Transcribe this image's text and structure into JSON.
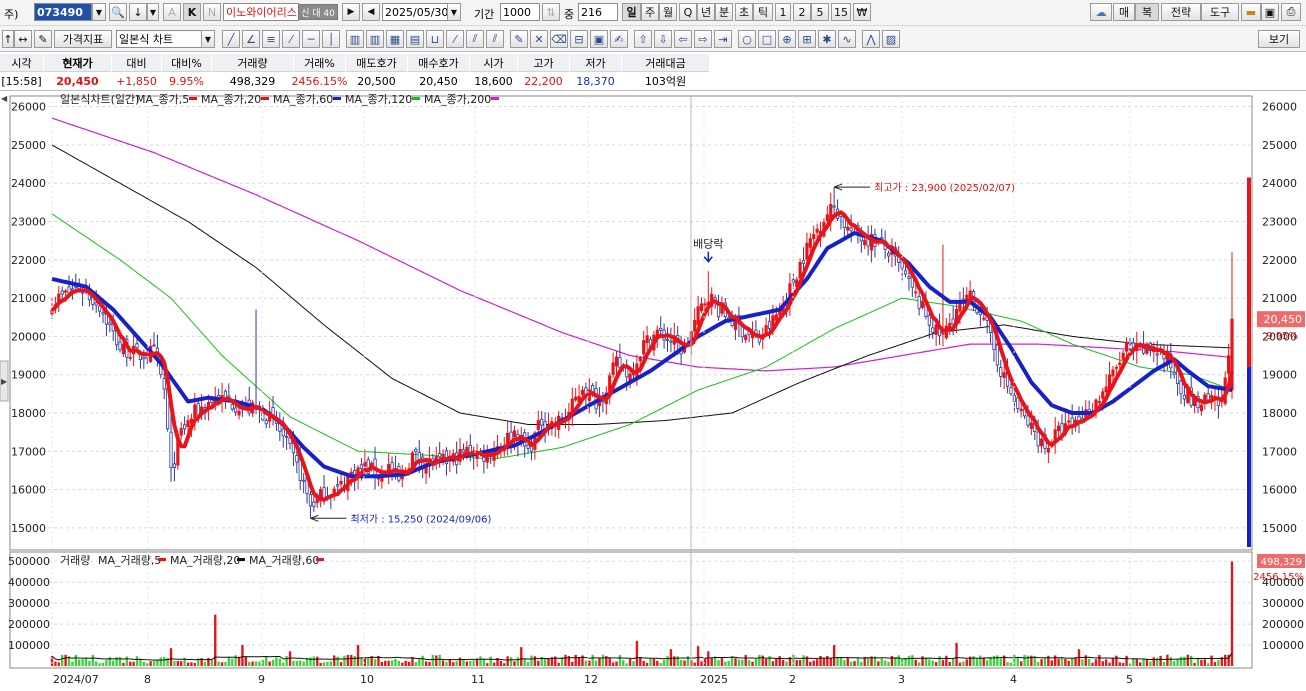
{
  "toolbar": {
    "code_label": "주)",
    "code_value": "073490",
    "stock_name": "이노와이어리스",
    "stock_badge": "신 대 40",
    "date_value": "2025/05/30",
    "period_label": "기간",
    "period_value": "1000",
    "count_label": "중",
    "count_value": "216",
    "buttons_top": [
      "일",
      "주",
      "월",
      "Q",
      "년",
      "분",
      "초",
      "틱",
      "1",
      "2",
      "5",
      "15",
      "₩"
    ],
    "right_buttons": [
      "매",
      "복",
      "전략",
      "도구"
    ],
    "letter_buttons": [
      "A",
      "K",
      "N"
    ],
    "indicator_label": "가격지표",
    "chart_type": "일본식 차트",
    "view_label": "보기"
  },
  "quote": {
    "headers": [
      "시각",
      "현재가",
      "대비",
      "대비%",
      "거래량",
      "거래%",
      "매도호가",
      "매수호가",
      "시가",
      "고가",
      "저가",
      "거래대금"
    ],
    "values": [
      "[15:58]",
      "20,450",
      "+1,850",
      "9.95%",
      "498,329",
      "2456.15%",
      "20,500",
      "20,450",
      "18,600",
      "22,200",
      "18,370",
      "103억원"
    ]
  },
  "legend": {
    "price_title": "일본식차트(일간)",
    "price_items": [
      {
        "label": "MA_종가,5",
        "color": "#e8141a"
      },
      {
        "label": "MA_종가,20",
        "color": "#e8141a"
      },
      {
        "label": "MA_종가,60",
        "color": "#1622c8"
      },
      {
        "label": "MA_종가,120",
        "color": "#19c019"
      },
      {
        "label": "MA_종가,200",
        "color": "#d020d0"
      }
    ],
    "volume_title": "거래량",
    "volume_items": [
      {
        "label": "MA_거래량,5",
        "color": "#e8141a"
      },
      {
        "label": "MA_거래량,20",
        "color": "#111111"
      },
      {
        "label": "MA_거래량,60",
        "color": "#e8141a"
      }
    ]
  },
  "annotations": {
    "high": "최고가 : 23,900 (2025/02/07)",
    "low": "최저가 : 15,250 (2024/09/06)",
    "dividend": "배당락"
  },
  "right_labels": {
    "price": "20,450",
    "pct": "9.95%",
    "volume": "498,329",
    "volume_pct": "2456.15%"
  },
  "chart_data": {
    "type": "candlestick",
    "price_axis": {
      "ticks": [
        15000,
        16000,
        17000,
        18000,
        19000,
        20000,
        21000,
        22000,
        23000,
        24000,
        25000,
        26000
      ],
      "ylim": [
        14500,
        26200
      ]
    },
    "volume_axis": {
      "ticks": [
        100000,
        200000,
        300000,
        400000,
        500000
      ],
      "ylim": [
        0,
        520000
      ]
    },
    "x_ticks": [
      "2024/07",
      "8",
      "9",
      "10",
      "11",
      "12",
      "2025",
      "2",
      "3",
      "4",
      "5"
    ],
    "close_anchors": [
      [
        0,
        20900
      ],
      [
        8,
        21300
      ],
      [
        14,
        20800
      ],
      [
        20,
        19700
      ],
      [
        26,
        19500
      ],
      [
        30,
        19600
      ],
      [
        33,
        18600
      ],
      [
        35,
        16400
      ],
      [
        38,
        17500
      ],
      [
        42,
        18000
      ],
      [
        48,
        18400
      ],
      [
        55,
        18200
      ],
      [
        62,
        18000
      ],
      [
        66,
        17700
      ],
      [
        70,
        17000
      ],
      [
        73,
        16400
      ],
      [
        76,
        15600
      ],
      [
        80,
        15900
      ],
      [
        84,
        16000
      ],
      [
        88,
        16400
      ],
      [
        92,
        16600
      ],
      [
        96,
        16400
      ],
      [
        99,
        16600
      ],
      [
        102,
        16200
      ],
      [
        106,
        16900
      ],
      [
        110,
        16700
      ],
      [
        114,
        16700
      ],
      [
        118,
        16800
      ],
      [
        122,
        17000
      ],
      [
        127,
        16900
      ],
      [
        132,
        17200
      ],
      [
        136,
        17500
      ],
      [
        140,
        17000
      ],
      [
        144,
        17800
      ],
      [
        148,
        17700
      ],
      [
        152,
        18000
      ],
      [
        156,
        18700
      ],
      [
        160,
        18300
      ],
      [
        162,
        18500
      ],
      [
        166,
        19300
      ],
      [
        170,
        19000
      ],
      [
        174,
        19800
      ],
      [
        178,
        20100
      ],
      [
        182,
        19900
      ],
      [
        186,
        19600
      ],
      [
        190,
        20600
      ],
      [
        193,
        21100
      ],
      [
        196,
        20700
      ],
      [
        200,
        20400
      ],
      [
        204,
        20100
      ],
      [
        208,
        19900
      ],
      [
        212,
        20400
      ],
      [
        216,
        21000
      ],
      [
        220,
        21900
      ],
      [
        223,
        22500
      ],
      [
        227,
        23100
      ],
      [
        230,
        23400
      ],
      [
        234,
        22800
      ],
      [
        238,
        22600
      ],
      [
        242,
        22500
      ],
      [
        246,
        22200
      ],
      [
        250,
        21700
      ],
      [
        253,
        21200
      ],
      [
        256,
        20700
      ],
      [
        260,
        20100
      ],
      [
        262,
        20000
      ],
      [
        266,
        20700
      ],
      [
        270,
        21000
      ],
      [
        274,
        20600
      ],
      [
        276,
        19900
      ],
      [
        280,
        18900
      ],
      [
        284,
        18100
      ],
      [
        288,
        17600
      ],
      [
        292,
        17100
      ],
      [
        296,
        17500
      ],
      [
        300,
        17700
      ],
      [
        304,
        18000
      ],
      [
        308,
        18400
      ],
      [
        312,
        19000
      ],
      [
        316,
        19700
      ],
      [
        320,
        19600
      ],
      [
        324,
        19700
      ],
      [
        328,
        19400
      ],
      [
        332,
        18700
      ],
      [
        336,
        18200
      ],
      [
        340,
        18300
      ],
      [
        344,
        18200
      ],
      [
        347,
        20450
      ]
    ],
    "ma20_anchors": [
      [
        0,
        21500
      ],
      [
        10,
        21300
      ],
      [
        18,
        20700
      ],
      [
        26,
        19900
      ],
      [
        32,
        19300
      ],
      [
        36,
        18800
      ],
      [
        40,
        18300
      ],
      [
        46,
        18400
      ],
      [
        54,
        18300
      ],
      [
        62,
        18100
      ],
      [
        68,
        17700
      ],
      [
        74,
        17100
      ],
      [
        80,
        16600
      ],
      [
        88,
        16350
      ],
      [
        96,
        16350
      ],
      [
        104,
        16400
      ],
      [
        112,
        16700
      ],
      [
        120,
        16850
      ],
      [
        128,
        17000
      ],
      [
        136,
        17150
      ],
      [
        144,
        17500
      ],
      [
        152,
        17900
      ],
      [
        160,
        18300
      ],
      [
        168,
        18700
      ],
      [
        176,
        19100
      ],
      [
        184,
        19600
      ],
      [
        190,
        20000
      ],
      [
        198,
        20400
      ],
      [
        206,
        20550
      ],
      [
        214,
        20700
      ],
      [
        222,
        21500
      ],
      [
        228,
        22300
      ],
      [
        236,
        22700
      ],
      [
        244,
        22500
      ],
      [
        252,
        21900
      ],
      [
        258,
        21300
      ],
      [
        264,
        20900
      ],
      [
        270,
        20900
      ],
      [
        276,
        20500
      ],
      [
        282,
        19700
      ],
      [
        288,
        18800
      ],
      [
        294,
        18200
      ],
      [
        300,
        18000
      ],
      [
        306,
        18000
      ],
      [
        312,
        18300
      ],
      [
        318,
        18700
      ],
      [
        324,
        19100
      ],
      [
        330,
        19400
      ],
      [
        334,
        19100
      ],
      [
        340,
        18700
      ],
      [
        347,
        18600
      ]
    ],
    "ma60_anchors": [
      [
        0,
        23200
      ],
      [
        20,
        22000
      ],
      [
        35,
        21000
      ],
      [
        50,
        19500
      ],
      [
        70,
        17900
      ],
      [
        90,
        17000
      ],
      [
        110,
        16900
      ],
      [
        130,
        16800
      ],
      [
        150,
        17100
      ],
      [
        170,
        17700
      ],
      [
        190,
        18600
      ],
      [
        210,
        19200
      ],
      [
        230,
        20200
      ],
      [
        250,
        21000
      ],
      [
        265,
        20800
      ],
      [
        285,
        20400
      ],
      [
        300,
        19800
      ],
      [
        320,
        19200
      ],
      [
        335,
        19000
      ],
      [
        347,
        18600
      ]
    ],
    "ma120_anchors": [
      [
        0,
        25000
      ],
      [
        20,
        24000
      ],
      [
        40,
        23000
      ],
      [
        60,
        21800
      ],
      [
        80,
        20300
      ],
      [
        100,
        18900
      ],
      [
        120,
        18000
      ],
      [
        140,
        17700
      ],
      [
        160,
        17700
      ],
      [
        180,
        17800
      ],
      [
        200,
        18000
      ],
      [
        220,
        18800
      ],
      [
        240,
        19500
      ],
      [
        260,
        20100
      ],
      [
        280,
        20300
      ],
      [
        300,
        20000
      ],
      [
        320,
        19800
      ],
      [
        347,
        19700
      ]
    ],
    "ma200_anchors": [
      [
        0,
        25700
      ],
      [
        30,
        24800
      ],
      [
        60,
        23700
      ],
      [
        90,
        22500
      ],
      [
        120,
        21200
      ],
      [
        150,
        20100
      ],
      [
        170,
        19500
      ],
      [
        190,
        19200
      ],
      [
        210,
        19100
      ],
      [
        230,
        19200
      ],
      [
        250,
        19500
      ],
      [
        270,
        19800
      ],
      [
        290,
        19800
      ],
      [
        310,
        19700
      ],
      [
        330,
        19600
      ],
      [
        347,
        19450
      ]
    ],
    "volume_spikes": [
      [
        35,
        85000
      ],
      [
        48,
        245000
      ],
      [
        56,
        100000
      ],
      [
        70,
        70000
      ],
      [
        90,
        100000
      ],
      [
        138,
        90000
      ],
      [
        172,
        120000
      ],
      [
        182,
        80000
      ],
      [
        190,
        95000
      ],
      [
        193,
        70000
      ],
      [
        230,
        100000
      ],
      [
        266,
        110000
      ],
      [
        302,
        80000
      ],
      [
        347,
        498329
      ]
    ],
    "volume_base": 32000,
    "n_bars": 348
  }
}
